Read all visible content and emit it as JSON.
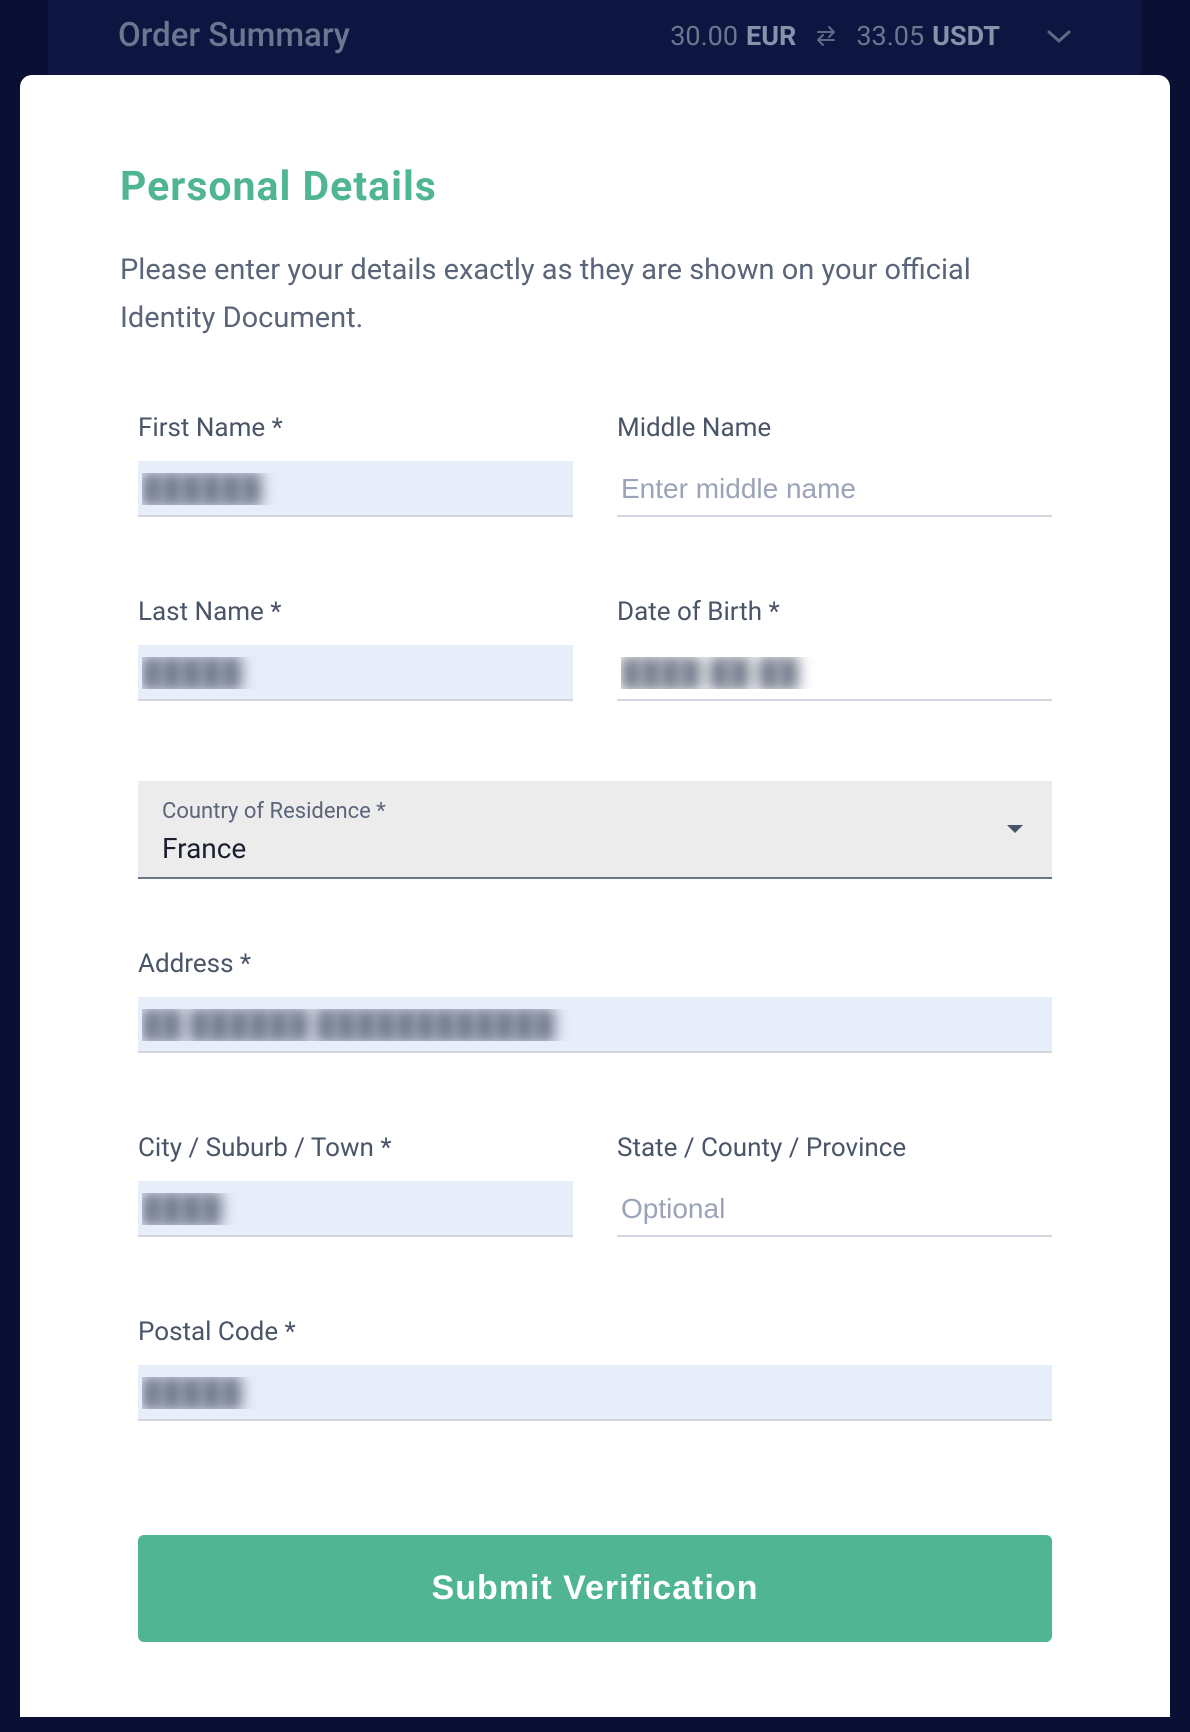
{
  "order_summary": {
    "title": "Order Summary",
    "from_amount": "30.00",
    "from_currency": "EUR",
    "to_amount": "33.05",
    "to_currency": "USDT"
  },
  "form": {
    "title": "Personal Details",
    "description": "Please enter your details exactly as they are shown on your official Identity Document.",
    "fields": {
      "first_name": {
        "label": "First Name *",
        "value": "██████"
      },
      "middle_name": {
        "label": "Middle Name",
        "placeholder": "Enter middle name",
        "value": ""
      },
      "last_name": {
        "label": "Last Name *",
        "value": "█████"
      },
      "dob": {
        "label": "Date of Birth *",
        "value": "████-██-██"
      },
      "country": {
        "label": "Country of Residence *",
        "value": "France"
      },
      "address": {
        "label": "Address *",
        "value": "██ ██████ ████████████"
      },
      "city": {
        "label": "City / Suburb / Town *",
        "value": "████"
      },
      "state": {
        "label": "State / County / Province",
        "placeholder": "Optional",
        "value": ""
      },
      "postal": {
        "label": "Postal Code *",
        "value": "█████"
      }
    },
    "submit_label": "Submit Verification"
  }
}
